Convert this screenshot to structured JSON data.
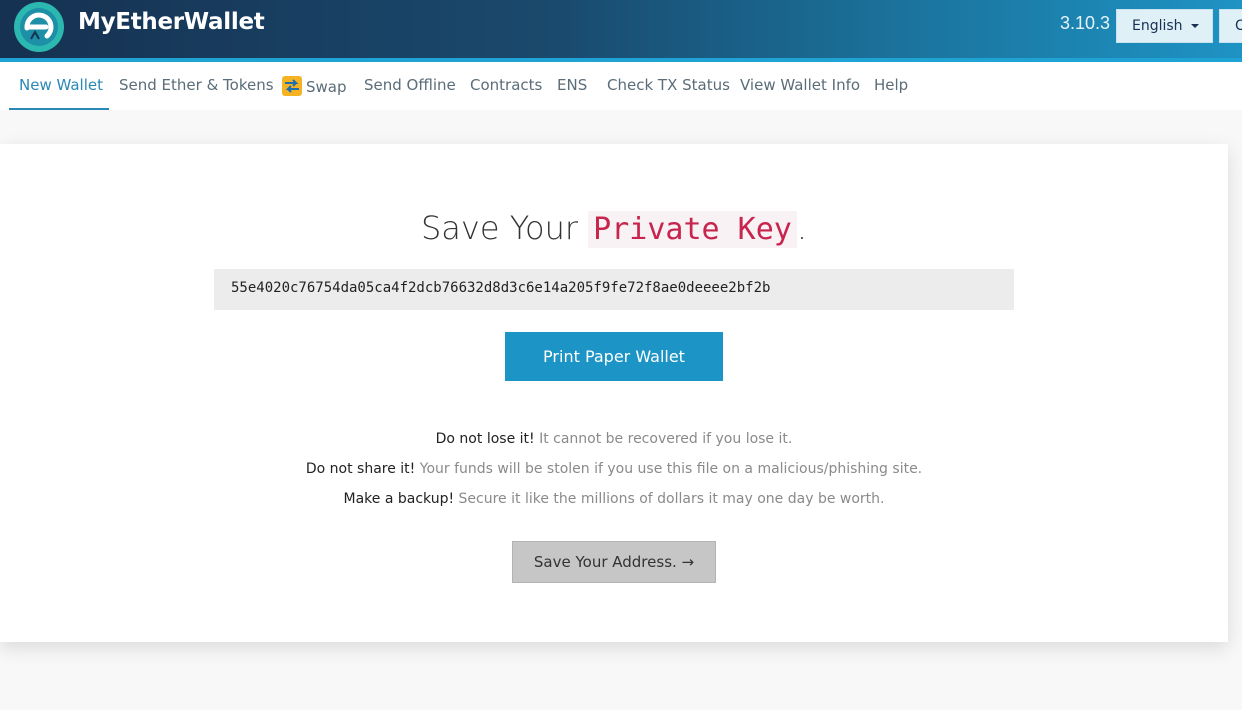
{
  "header": {
    "brand": "MyEtherWallet",
    "version": "3.10.3",
    "language": "English",
    "node_label": "C"
  },
  "nav": {
    "items": [
      {
        "label": "New Wallet",
        "active": true
      },
      {
        "label": "Send Ether & Tokens"
      },
      {
        "label": "Swap",
        "icon": "swap-icon"
      },
      {
        "label": "Send Offline"
      },
      {
        "label": "Contracts"
      },
      {
        "label": "ENS"
      },
      {
        "label": "Check TX Status"
      },
      {
        "label": "View Wallet Info"
      },
      {
        "label": "Help"
      }
    ]
  },
  "main": {
    "title_prefix": "Save Your",
    "title_code": "Private Key",
    "title_suffix": ".",
    "private_key": "55e4020c76754da05ca4f2dcb76632d8d3c6e14a205f9fe72f8ae0deeee2bf2b",
    "print_button": "Print Paper Wallet",
    "warnings": [
      {
        "strong": "Do not lose it!",
        "text": "It cannot be recovered if you lose it."
      },
      {
        "strong": "Do not share it!",
        "text": "Your funds will be stolen if you use this file on a malicious/phishing site."
      },
      {
        "strong": "Make a backup!",
        "text": "Secure it like the millions of dollars it may one day be worth."
      }
    ],
    "next_button": "Save Your Address. →"
  },
  "colors": {
    "header_dark": "#163151",
    "header_light": "#1e93c4",
    "accent": "#2a88b5",
    "primary_button": "#1d94c6",
    "code_text": "#c7254e"
  }
}
